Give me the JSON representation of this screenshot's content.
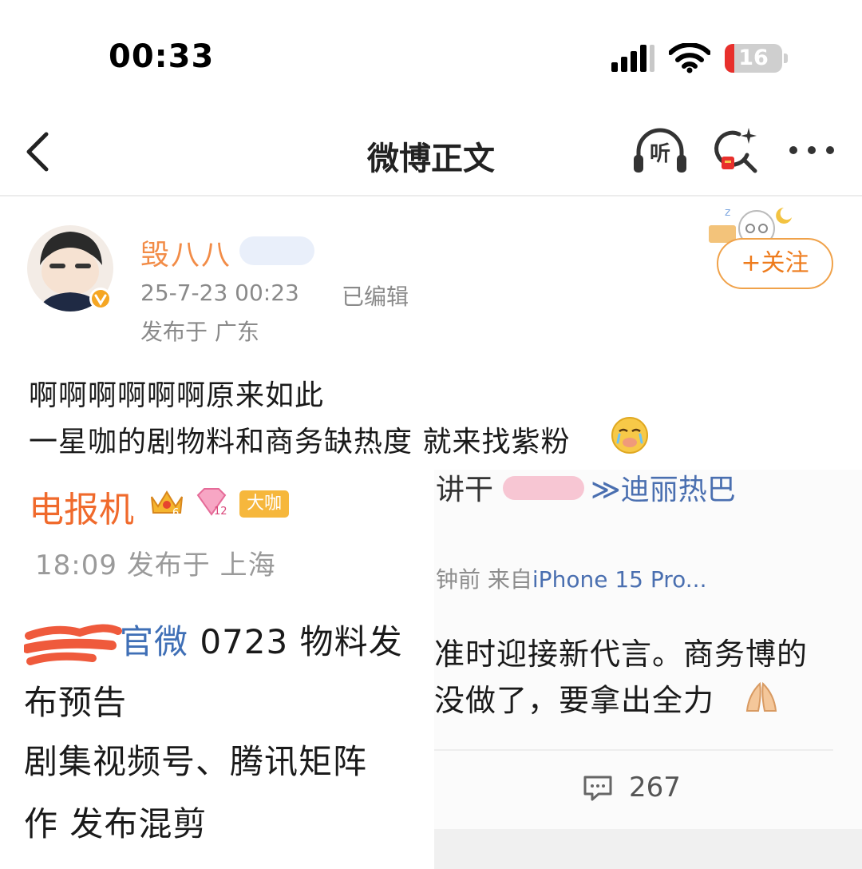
{
  "status_bar": {
    "time": "00:33",
    "battery_level": "16",
    "battery_fraction": 0.16,
    "battery_color": "#e8302c"
  },
  "nav": {
    "title": "微博正文",
    "listen_label": "听",
    "icons": [
      "back-icon",
      "listen-icon",
      "search-ai-icon",
      "more-icon"
    ]
  },
  "author": {
    "name": "毁八八",
    "post_time": "25-7-23 00:23",
    "edited": "已编辑",
    "location": "发布于 广东",
    "follow_label": "+关注",
    "accent": "#f0a24a"
  },
  "post": {
    "line1": "啊啊啊啊啊啊原来如此",
    "line2": "一星咖的剧物料和商务缺热度 就来找紫粉"
  },
  "image_left": {
    "name": "电报机",
    "crown_level": "6",
    "diamond_level": "12",
    "badge": "大咖",
    "meta": "18:09  发布于 上海",
    "line1_link": "官微",
    "line1_text": " 0723 物料发",
    "line2": "布预告",
    "line3": "剧集视频号、腾讯矩阵",
    "line4": "作 发布混剪"
  },
  "image_right": {
    "top_text": "讲干",
    "top_link": "≫迪丽热巴",
    "meta_prefix": "钟前  来自",
    "device": "iPhone 15 Pro...",
    "line1": "准时迎接新代言。商务博的",
    "line2": "没做了，要拿出全力",
    "comment_count": "267"
  }
}
